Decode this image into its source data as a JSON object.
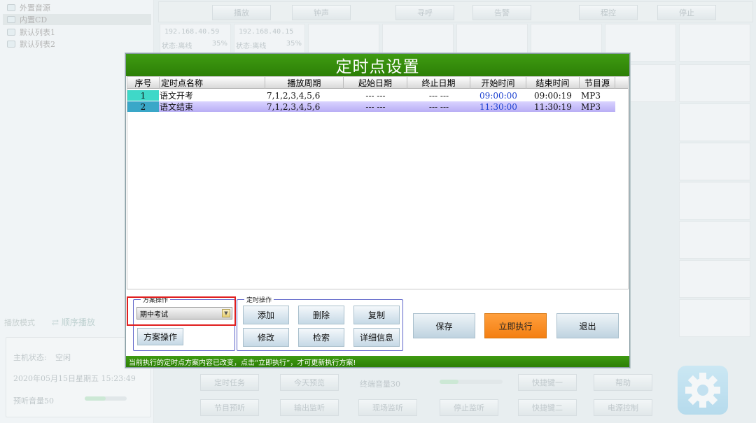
{
  "sidebar": {
    "items": [
      {
        "label": "外置音源",
        "selected": false
      },
      {
        "label": "内置CD",
        "selected": true
      },
      {
        "label": "默认列表1",
        "selected": false
      },
      {
        "label": "默认列表2",
        "selected": false
      }
    ],
    "play_mode_label": "播放模式",
    "play_mode_value": "顺序播放",
    "host_status_label": "主机状态:",
    "host_status_value": "空闲",
    "datetime": "2020年05月15日星期五  15:23:49",
    "preview_volume_label": "预听音量50",
    "preview_volume_level": 0.5
  },
  "topbar": {
    "buttons": [
      "播放",
      "钟声",
      "寻呼",
      "告警",
      "",
      "程控",
      "停止"
    ]
  },
  "zones": [
    {
      "ip": "192.168.40.59",
      "status": "状态:离线",
      "pct": "35%"
    },
    {
      "ip": "192.168.40.15",
      "status": "状态:离线",
      "pct": "35%"
    }
  ],
  "bottom": {
    "row1": [
      "定时任务",
      "今天预览",
      "快捷键一",
      "帮助"
    ],
    "terminal_volume_label": "终端音量30",
    "terminal_volume_level": 0.3,
    "row2": [
      "节目预听",
      "输出监听",
      "现场监听",
      "停止监听",
      "快捷键二",
      "电源控制"
    ]
  },
  "modal": {
    "title": "定时点设置",
    "columns": [
      "序号",
      "定时点名称",
      "播放周期",
      "起始日期",
      "终止日期",
      "开始时间",
      "结束时间",
      "节目源"
    ],
    "rows": [
      {
        "idx": "1",
        "name": "语文开考",
        "cycle": "7,1,2,3,4,5,6",
        "start_date": "--- ---",
        "end_date": "--- ---",
        "start_time": "09:00:00",
        "end_time": "09:00:19",
        "source": "MP3"
      },
      {
        "idx": "2",
        "name": "语文结束",
        "cycle": "7,1,2,3,4,5,6",
        "start_date": "--- ---",
        "end_date": "--- ---",
        "start_time": "11:30:00",
        "end_time": "11:30:19",
        "source": "MP3"
      }
    ],
    "scheme_group_title": "方案操作",
    "scheme_selected": "期中考试",
    "scheme_button": "方案操作",
    "timer_group_title": "定时操作",
    "timer_buttons": {
      "add": "添加",
      "delete": "删除",
      "copy": "复制",
      "edit": "修改",
      "search": "检索",
      "detail": "详细信息"
    },
    "save": "保存",
    "execute_now": "立即执行",
    "exit": "退出",
    "status": "当前执行的定时点方案内容已改变，点击“立即执行”，才可更新执行方案!",
    "colors": {
      "title_green": "#2c7f06",
      "execute_orange": "#f47f12",
      "highlight_red": "#e01e1e"
    }
  }
}
